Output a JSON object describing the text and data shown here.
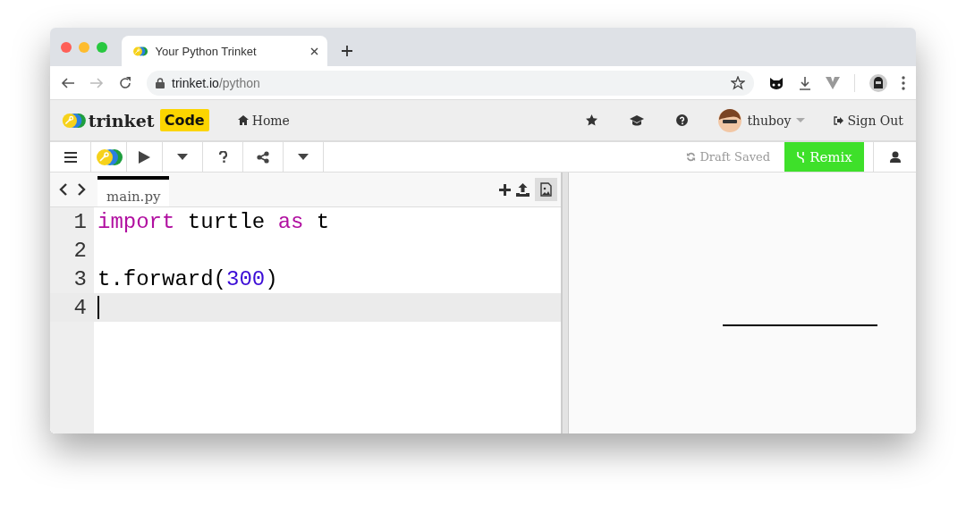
{
  "browser": {
    "tab": {
      "title": "Your Python Trinket",
      "selected": true
    },
    "address": {
      "host": "trinket.io",
      "path": "/python"
    }
  },
  "site_nav": {
    "logo_text": "trinket",
    "product": "Code",
    "home": "Home",
    "user": "thuboy",
    "sign_out": "Sign Out"
  },
  "toolbar": {
    "status": "Draft Saved",
    "remix": "Remix"
  },
  "editor": {
    "file_tab": {
      "label": "main.py",
      "selected": true
    },
    "lines": [
      {
        "number": "1",
        "current": false,
        "tokens": [
          {
            "kind": "keyword",
            "text": "import"
          },
          {
            "kind": "plain",
            "text": " turtle "
          },
          {
            "kind": "keyword",
            "text": "as"
          },
          {
            "kind": "plain",
            "text": " t"
          }
        ]
      },
      {
        "number": "2",
        "current": false
      },
      {
        "number": "3",
        "current": false,
        "tokens": [
          {
            "kind": "plain",
            "text": "t.forward("
          },
          {
            "kind": "number",
            "text": "300"
          },
          {
            "kind": "plain",
            "text": ")"
          }
        ]
      },
      {
        "number": "4",
        "current": true
      }
    ]
  }
}
